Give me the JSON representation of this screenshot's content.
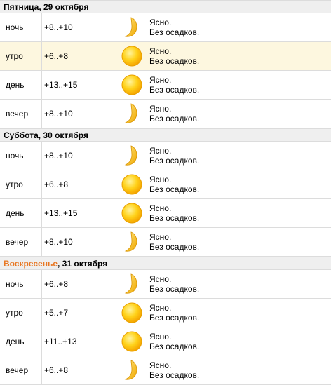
{
  "days": [
    {
      "label_day": "Пятница",
      "label_date": ", 29 октября",
      "weekend": false,
      "periods": [
        {
          "time": "ночь",
          "temp": "+8..+10",
          "icon": "moon-icon",
          "cond": "Ясно.",
          "precip": "Без осадков."
        },
        {
          "time": "утро",
          "temp": "+6..+8",
          "icon": "sun-icon",
          "cond": "Ясно.",
          "precip": "Без осадков.",
          "highlight": true
        },
        {
          "time": "день",
          "temp": "+13..+15",
          "icon": "sun-icon",
          "cond": "Ясно.",
          "precip": "Без осадков."
        },
        {
          "time": "вечер",
          "temp": "+8..+10",
          "icon": "moon-icon",
          "cond": "Ясно.",
          "precip": "Без осадков."
        }
      ]
    },
    {
      "label_day": "Суббота",
      "label_date": ", 30 октября",
      "weekend": false,
      "periods": [
        {
          "time": "ночь",
          "temp": "+8..+10",
          "icon": "moon-icon",
          "cond": "Ясно.",
          "precip": "Без осадков."
        },
        {
          "time": "утро",
          "temp": "+6..+8",
          "icon": "sun-icon",
          "cond": "Ясно.",
          "precip": "Без осадков."
        },
        {
          "time": "день",
          "temp": "+13..+15",
          "icon": "sun-icon",
          "cond": "Ясно.",
          "precip": "Без осадков."
        },
        {
          "time": "вечер",
          "temp": "+8..+10",
          "icon": "moon-icon",
          "cond": "Ясно.",
          "precip": "Без осадков."
        }
      ]
    },
    {
      "label_day": "Воскресенье",
      "label_date": ", 31 октября",
      "weekend": true,
      "periods": [
        {
          "time": "ночь",
          "temp": "+6..+8",
          "icon": "moon-icon",
          "cond": "Ясно.",
          "precip": "Без осадков."
        },
        {
          "time": "утро",
          "temp": "+5..+7",
          "icon": "sun-icon",
          "cond": "Ясно.",
          "precip": "Без осадков."
        },
        {
          "time": "день",
          "temp": "+11..+13",
          "icon": "sun-icon",
          "cond": "Ясно.",
          "precip": "Без осадков."
        },
        {
          "time": "вечер",
          "temp": "+6..+8",
          "icon": "moon-icon",
          "cond": "Ясно.",
          "precip": "Без осадков."
        }
      ]
    }
  ],
  "colors": {
    "weekend_text": "#e87722",
    "header_bg": "#efefef",
    "highlight_row": "#fdf7df",
    "sun": "#ffc000",
    "moon": "#ffcc33",
    "divider": "#dcdcdc"
  }
}
